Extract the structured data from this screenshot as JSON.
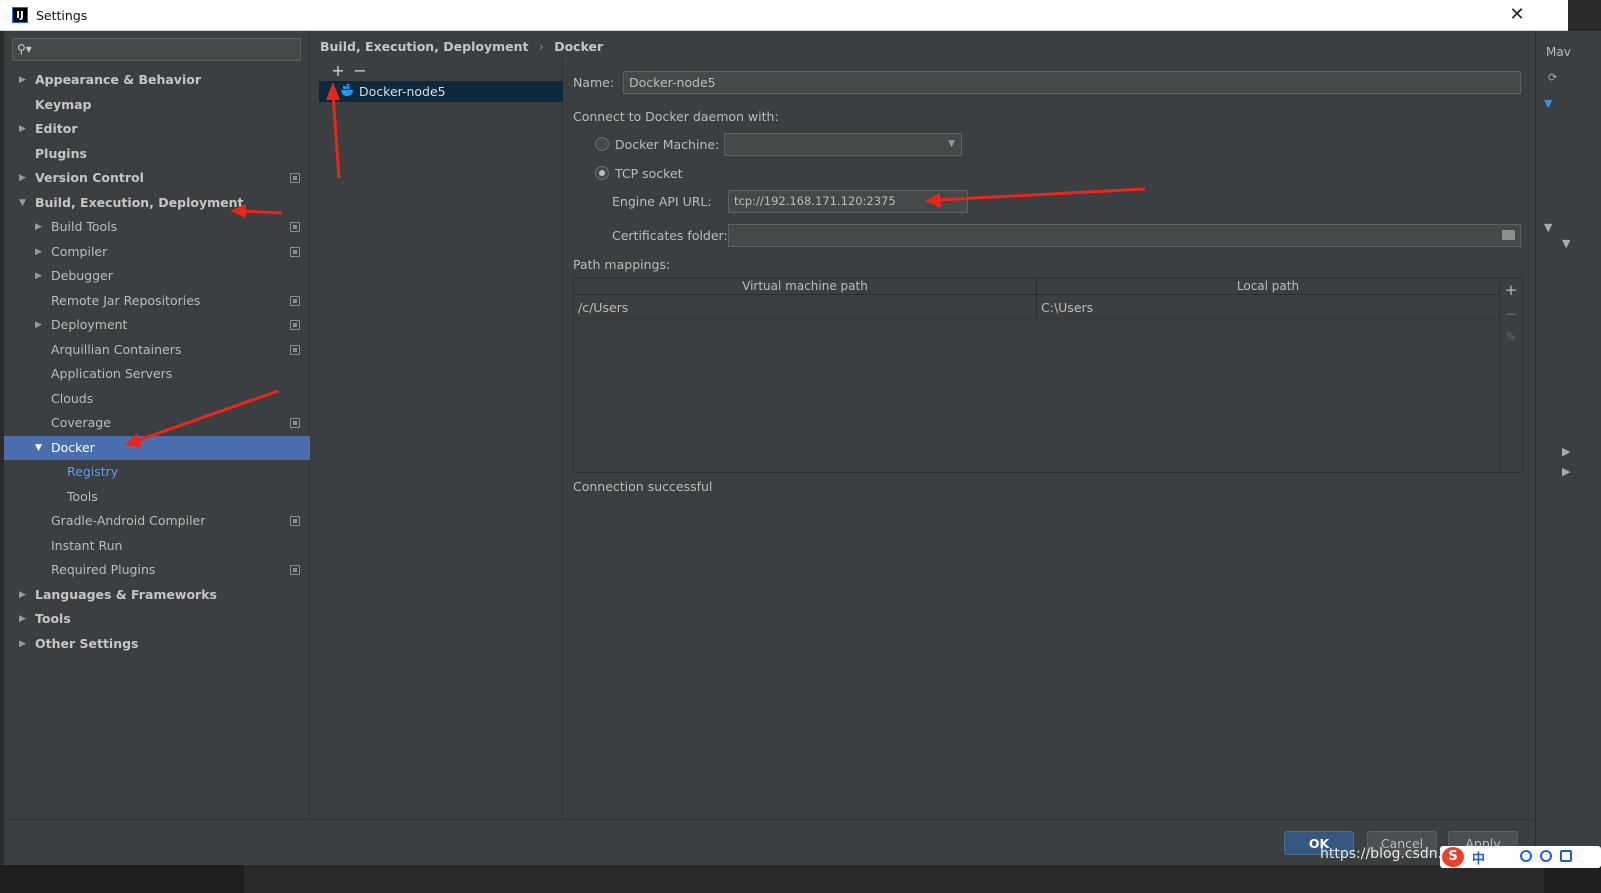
{
  "window": {
    "title": "Settings",
    "app_icon": "IJ",
    "close_glyph": "✕"
  },
  "search": {
    "placeholder": "",
    "icon": "search-icon"
  },
  "tree": [
    {
      "label": "Appearance & Behavior",
      "level": 0,
      "expand": "collapsed",
      "bold": true,
      "cfg": false
    },
    {
      "label": "Keymap",
      "level": 0,
      "expand": "none",
      "bold": true,
      "cfg": false
    },
    {
      "label": "Editor",
      "level": 0,
      "expand": "collapsed",
      "bold": true,
      "cfg": false
    },
    {
      "label": "Plugins",
      "level": 0,
      "expand": "none",
      "bold": true,
      "cfg": false
    },
    {
      "label": "Version Control",
      "level": 0,
      "expand": "collapsed",
      "bold": true,
      "cfg": true
    },
    {
      "label": "Build, Execution, Deployment",
      "level": 0,
      "expand": "expanded",
      "bold": true,
      "cfg": false
    },
    {
      "label": "Build Tools",
      "level": 1,
      "expand": "collapsed",
      "bold": false,
      "cfg": true
    },
    {
      "label": "Compiler",
      "level": 1,
      "expand": "collapsed",
      "bold": false,
      "cfg": true
    },
    {
      "label": "Debugger",
      "level": 1,
      "expand": "collapsed",
      "bold": false,
      "cfg": false
    },
    {
      "label": "Remote Jar Repositories",
      "level": 1,
      "expand": "none",
      "bold": false,
      "cfg": true
    },
    {
      "label": "Deployment",
      "level": 1,
      "expand": "collapsed",
      "bold": false,
      "cfg": true
    },
    {
      "label": "Arquillian Containers",
      "level": 1,
      "expand": "none",
      "bold": false,
      "cfg": true
    },
    {
      "label": "Application Servers",
      "level": 1,
      "expand": "none",
      "bold": false,
      "cfg": false
    },
    {
      "label": "Clouds",
      "level": 1,
      "expand": "none",
      "bold": false,
      "cfg": false
    },
    {
      "label": "Coverage",
      "level": 1,
      "expand": "none",
      "bold": false,
      "cfg": true
    },
    {
      "label": "Docker",
      "level": 1,
      "expand": "expanded",
      "bold": false,
      "cfg": false,
      "selected": true
    },
    {
      "label": "Registry",
      "level": 2,
      "expand": "none",
      "bold": false,
      "cfg": false,
      "link": true
    },
    {
      "label": "Tools",
      "level": 2,
      "expand": "none",
      "bold": false,
      "cfg": false
    },
    {
      "label": "Gradle-Android Compiler",
      "level": 1,
      "expand": "none",
      "bold": false,
      "cfg": true
    },
    {
      "label": "Instant Run",
      "level": 1,
      "expand": "none",
      "bold": false,
      "cfg": false
    },
    {
      "label": "Required Plugins",
      "level": 1,
      "expand": "none",
      "bold": false,
      "cfg": true
    },
    {
      "label": "Languages & Frameworks",
      "level": 0,
      "expand": "collapsed",
      "bold": true,
      "cfg": false
    },
    {
      "label": "Tools",
      "level": 0,
      "expand": "collapsed",
      "bold": true,
      "cfg": false
    },
    {
      "label": "Other Settings",
      "level": 0,
      "expand": "collapsed",
      "bold": true,
      "cfg": false
    }
  ],
  "breadcrumb": {
    "parent": "Build, Execution, Deployment",
    "separator": "›",
    "current": "Docker"
  },
  "list_toolbar": {
    "add": "+",
    "remove": "−"
  },
  "server": {
    "name": "Docker-node5",
    "icon": "docker-whale-icon"
  },
  "form": {
    "name_label": "Name:",
    "name_value": "Docker-node5",
    "connect_label": "Connect to Docker daemon with:",
    "docker_machine_label": "Docker Machine:",
    "docker_machine_value": "",
    "tcp_socket_label": "TCP socket",
    "engine_api_url_label": "Engine API URL:",
    "engine_api_url_value": "tcp://192.168.171.120:2375",
    "certificates_label": "Certificates folder:",
    "certificates_value": "",
    "path_mappings_label": "Path mappings:",
    "status": "Connection successful"
  },
  "path_mappings": {
    "columns": [
      "Virtual machine path",
      "Local path"
    ],
    "rows": [
      [
        "/c/Users",
        "C:\\Users"
      ]
    ],
    "tools": {
      "add": "+",
      "remove": "−",
      "edit": "✎"
    }
  },
  "buttons": {
    "help": "?",
    "ok": "OK",
    "cancel": "Cancel",
    "apply": "Apply"
  },
  "ide_strip": {
    "label": "Mav"
  },
  "watermark": "https://blog.csdn.n",
  "ime": {
    "logo": "S",
    "lang": "中"
  },
  "colors": {
    "accent": "#4b6eaf",
    "annotation": "#e8261c",
    "link": "#589df6"
  }
}
